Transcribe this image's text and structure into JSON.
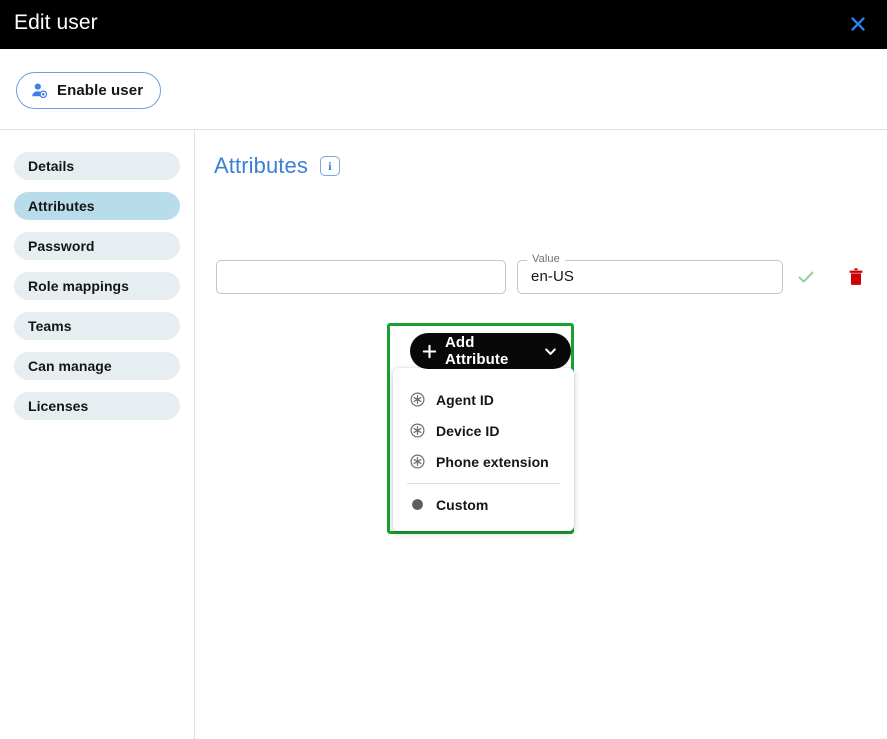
{
  "window": {
    "title": "Edit user",
    "close_icon": "close-x-icon"
  },
  "toolbar": {
    "enable_user_label": "Enable user",
    "enable_user_icon": "user-enable-icon"
  },
  "sidebar": {
    "items": [
      {
        "label": "Details",
        "active": false
      },
      {
        "label": "Attributes",
        "active": true
      },
      {
        "label": "Password",
        "active": false
      },
      {
        "label": "Role mappings",
        "active": false
      },
      {
        "label": "Teams",
        "active": false
      },
      {
        "label": "Can manage",
        "active": false
      },
      {
        "label": "Licenses",
        "active": false
      }
    ]
  },
  "main": {
    "section_title": "Attributes",
    "info_icon": "info-icon",
    "info_glyph": "i",
    "attribute_row": {
      "key_legend": "",
      "key_value": "",
      "value_legend": "Value",
      "value_value": "en-US",
      "confirm_icon": "check-icon",
      "delete_icon": "trash-icon"
    },
    "add_attribute": {
      "label": "Add Attribute",
      "plus_icon": "plus-icon",
      "chevron_icon": "chevron-down-icon",
      "menu": [
        {
          "label": "Agent ID",
          "icon": "asterisk-circle-icon",
          "separator_after": false
        },
        {
          "label": "Device ID",
          "icon": "asterisk-circle-icon",
          "separator_after": false
        },
        {
          "label": "Phone extension",
          "icon": "asterisk-circle-icon",
          "separator_after": true
        },
        {
          "label": "Custom",
          "icon": "filled-circle-icon",
          "separator_after": false
        }
      ]
    }
  },
  "colors": {
    "titlebar_bg": "#000000",
    "accent_blue": "#3b7fd4",
    "nav_active_bg": "#b9dcea",
    "nav_bg": "#e7eef1",
    "highlight_green": "#19a032",
    "check_green": "#8fd19e",
    "trash_red": "#cc0000",
    "button_black": "#080808"
  }
}
